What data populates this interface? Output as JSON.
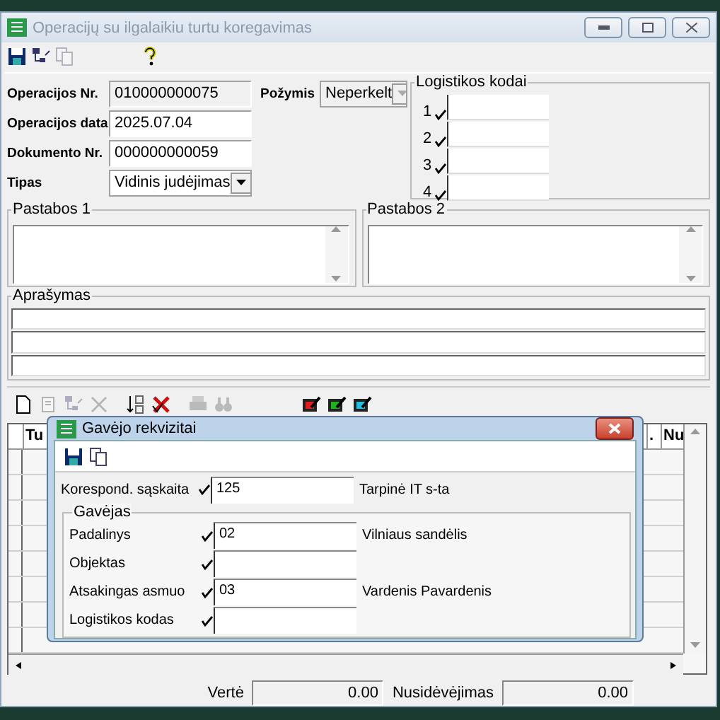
{
  "window": {
    "title": "Operacijų su ilgalaikiu turtu koregavimas"
  },
  "toolbar": [
    {
      "kind": "save",
      "disabled": false
    },
    {
      "kind": "tree",
      "disabled": false
    },
    {
      "kind": "copy",
      "disabled": true
    },
    {
      "kind": "gap"
    },
    {
      "kind": "help",
      "disabled": false
    }
  ],
  "fields": [
    {
      "label": "Operacijos Nr.",
      "value": "010000000075",
      "kind": "text",
      "readonly": true
    },
    {
      "label": "Operacijos data",
      "value": "2025.07.04",
      "kind": "text",
      "readonly": false
    },
    {
      "label": "Dokumento Nr.",
      "value": "000000000059",
      "kind": "text",
      "readonly": false
    },
    {
      "label": "Tipas",
      "value": "Vidinis judėjimas",
      "kind": "dropdown",
      "readonly": false
    }
  ],
  "attribute": {
    "label": "Požymis",
    "value": "Neperkelt",
    "disabled": true
  },
  "logistics": {
    "title": "Logistikos kodai",
    "items": [
      {
        "label": "1"
      },
      {
        "label": "2"
      },
      {
        "label": "3"
      },
      {
        "label": "4"
      }
    ]
  },
  "notes": [
    {
      "title": "Pastabos 1"
    },
    {
      "title": "Pastabos 2"
    }
  ],
  "description": {
    "title": "Aprašymas"
  },
  "grid_toolbar": [
    {
      "kind": "new",
      "disabled": false
    },
    {
      "kind": "page",
      "disabled": true
    },
    {
      "kind": "tree",
      "disabled": true
    },
    {
      "kind": "delete",
      "disabled": true
    },
    {
      "kind": "sep"
    },
    {
      "kind": "sort",
      "disabled": false
    },
    {
      "kind": "cancel",
      "disabled": false
    },
    {
      "kind": "sep"
    },
    {
      "kind": "print",
      "disabled": true
    },
    {
      "kind": "find",
      "disabled": true
    },
    {
      "kind": "gap"
    },
    {
      "kind": "edit",
      "color": "#e02020",
      "disabled": false
    },
    {
      "kind": "edit",
      "color": "#20b020",
      "disabled": false
    },
    {
      "kind": "edit",
      "color": "#20c0e0",
      "disabled": false
    }
  ],
  "grid": {
    "columns": [
      {
        "label": "Tu"
      },
      {
        "label": "."
      },
      {
        "label": "Nu"
      }
    ]
  },
  "totals": [
    {
      "label": "Vertė",
      "value": "0.00"
    },
    {
      "label": "Nusidėvėjimas",
      "value": "0.00"
    }
  ],
  "dialog": {
    "title": "Gavėjo rekvizitai",
    "toolbar": [
      {
        "kind": "save",
        "disabled": false
      },
      {
        "kind": "copy",
        "disabled": false
      }
    ],
    "account": {
      "label": "Korespond. sąskaita",
      "value": "125",
      "description": "Tarpinė IT s-ta"
    },
    "group": {
      "title": "Gavėjas",
      "rows": [
        {
          "label": "Padalinys",
          "value": "02",
          "description": "Vilniaus sandėlis"
        },
        {
          "label": "Objektas"
        },
        {
          "label": "Atsakingas asmuo",
          "value": "03",
          "description": "Vardenis Pavardenis"
        },
        {
          "label": "Logistikos kodas"
        }
      ]
    }
  }
}
